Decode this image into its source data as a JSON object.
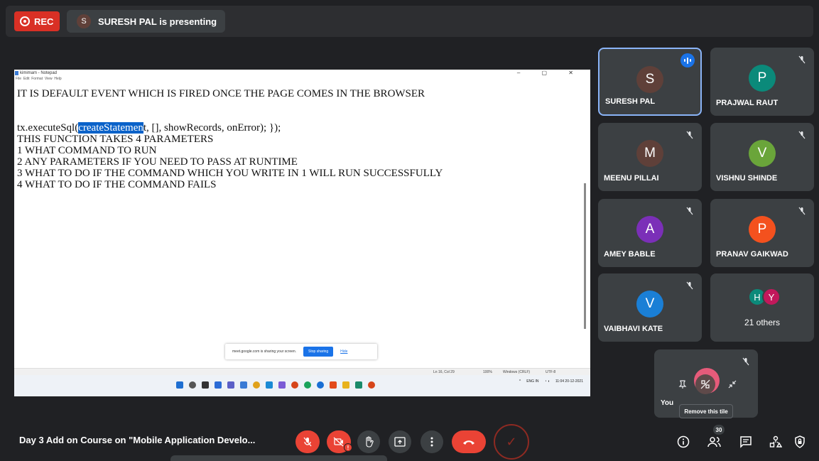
{
  "topbar": {
    "rec_label": "REC",
    "presenter_initial": "S",
    "presenter_text": "SURESH PAL is presenting"
  },
  "notepad": {
    "window_title": "kimimam - Notepad",
    "window_controls": "– ▢ ✕",
    "menu": [
      "File",
      "Edit",
      "Format",
      "View",
      "Help"
    ],
    "lines": [
      "IT IS DEFAULT EVENT WHICH IS FIRED ONCE THE PAGE COMES IN THE BROWSER",
      "",
      "",
      "tx.executeSql(",
      "createStatemen",
      "t, [], showRecords, onError); });",
      "THIS FUNCTION TAKES 4 PARAMETERS",
      "1 WHAT COMMAND TO RUN",
      "2 ANY PARAMETERS IF YOU NEED TO PASS AT RUNTIME",
      "3 WHAT TO DO IF THE COMMAND WHICH YOU WRITE IN 1 WILL RUN SUCCESSFULLY",
      "4 WHAT TO DO IF THE COMMAND FAILS"
    ],
    "status": {
      "position": "Ln 16, Col 29",
      "zoom": "100%",
      "line_ending": "Windows (CRLF)",
      "encoding": "UTF-8"
    },
    "share_bar": {
      "text": "meet.google.com is sharing your screen.",
      "stop": "Stop sharing",
      "hide": "Hide"
    },
    "tray": {
      "lang": "ENG",
      "region": "IN",
      "time": "11:04",
      "date": "20-12-2021"
    }
  },
  "participants": [
    {
      "initial": "S",
      "name": "SURESH PAL",
      "color": "#5f4039",
      "speaking": true
    },
    {
      "initial": "P",
      "name": "PRAJWAL RAUT",
      "color": "#0b8a7a",
      "speaking": false
    },
    {
      "initial": "M",
      "name": "MEENU PILLAI",
      "color": "#5f4039",
      "speaking": false
    },
    {
      "initial": "V",
      "name": "VISHNU SHINDE",
      "color": "#6aa53a",
      "speaking": false
    },
    {
      "initial": "A",
      "name": "AMEY BABLE",
      "color": "#7b2fb8",
      "speaking": false
    },
    {
      "initial": "P",
      "name": "PRANAV GAIKWAD",
      "color": "#f4511e",
      "speaking": false
    },
    {
      "initial": "V",
      "name": "VAIBHAVI KATE",
      "color": "#1a7fd6",
      "speaking": false
    }
  ],
  "others_tile": {
    "initials": [
      "H",
      "Y"
    ],
    "colors": [
      "#0b8a7a",
      "#c2185b"
    ],
    "label": "21 others"
  },
  "self_tile": {
    "label": "You",
    "tooltip": "Remove this tile"
  },
  "bottom": {
    "meeting_title": "Day 3 Add on Course on \"Mobile Application Develo...",
    "people_count": "30",
    "camera_badge": "!"
  },
  "icons": {
    "mic_off": "mic-off-icon",
    "cam_off": "camera-off-icon",
    "hand": "raise-hand-icon",
    "present": "present-icon",
    "more": "more-options-icon",
    "end_call": "end-call-icon",
    "info": "info-icon",
    "people": "people-icon",
    "chat": "chat-icon",
    "activities": "activities-icon",
    "host": "host-controls-icon"
  }
}
